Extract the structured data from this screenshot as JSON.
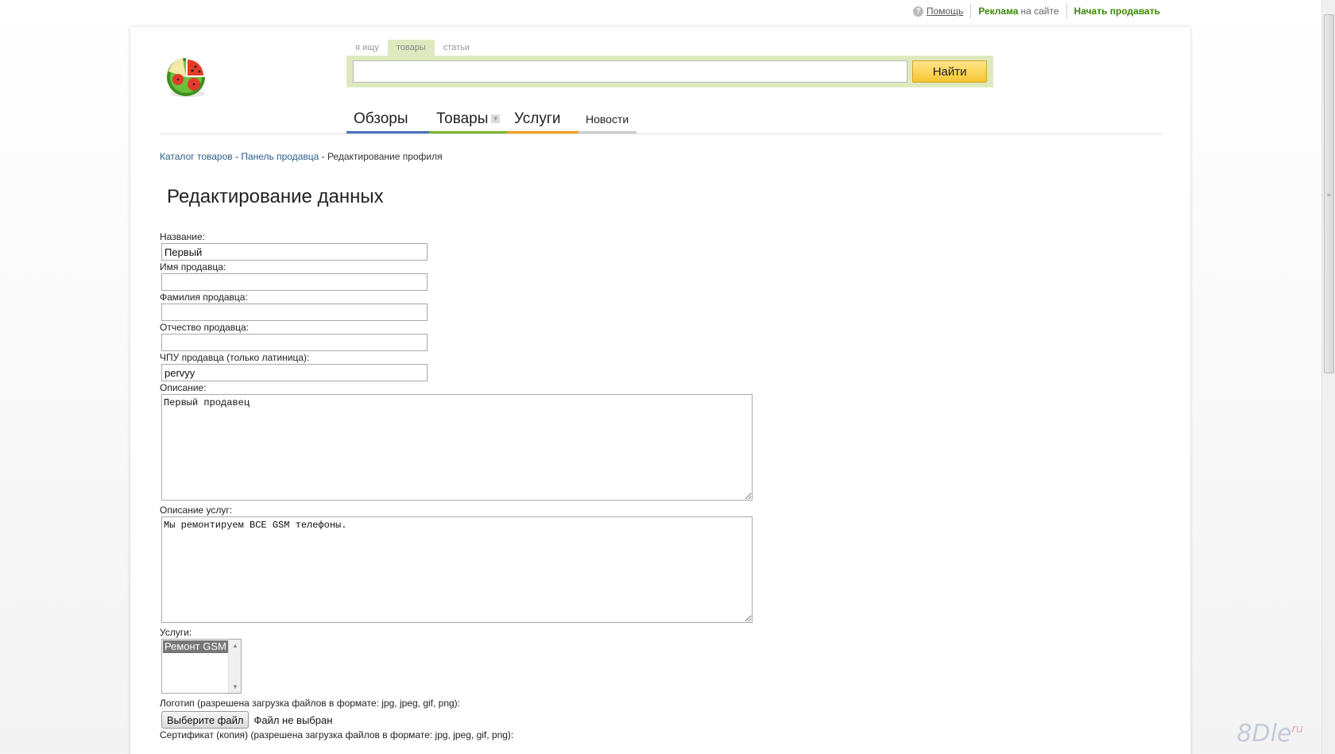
{
  "topbar": {
    "help": "Помощь",
    "ads_bold": "Реклама",
    "ads_rest": "на сайте",
    "sell": "Начать продавать"
  },
  "search": {
    "tabs": [
      "я ищу",
      "товары",
      "статьи"
    ],
    "active_tab": "товары",
    "input_value": "",
    "button": "Найти"
  },
  "nav": [
    {
      "label": "Обзоры",
      "color": "#4a72c0"
    },
    {
      "label": "Товары",
      "color": "#7cb82c"
    },
    {
      "label": "Услуги",
      "color": "#f0a020"
    },
    {
      "label": "Новости",
      "color": "#cfcfcf"
    }
  ],
  "breadcrumb": {
    "catalog": "Каталог товаров",
    "seller_panel": "Панель продавца",
    "current": "Редактирование профиля",
    "separator": " - "
  },
  "page_title": "Редактирование данных",
  "form": {
    "name_label": "Название:",
    "name_value": "Первый",
    "first_name_label": "Имя продавца:",
    "first_name_value": "",
    "last_name_label": "Фамилия продавца:",
    "last_name_value": "",
    "patronymic_label": "Отчество продавца:",
    "patronymic_value": "",
    "slug_label": "ЧПУ продавца (только латиница):",
    "slug_value": "pervyy",
    "description_label": "Описание:",
    "description_value": "Первый продавец",
    "services_desc_label": "Описание услуг:",
    "services_desc_value": "Мы ремонтируем ВСЕ GSM телефоны.",
    "services_label": "Услуги:",
    "services_options": [
      "Ремонт GSM"
    ],
    "logo_label": "Логотип (разрешена загрузка файлов в формате: jpg, jpeg, gif, png):",
    "file_button": "Выберите файл",
    "file_status": "Файл не выбран",
    "certificate_label": "Сертификат (копия) (разрешена загрузка файлов в формате: jpg, jpeg, gif, png):"
  },
  "watermark": {
    "main": "8Dle",
    "sup": "ru"
  }
}
